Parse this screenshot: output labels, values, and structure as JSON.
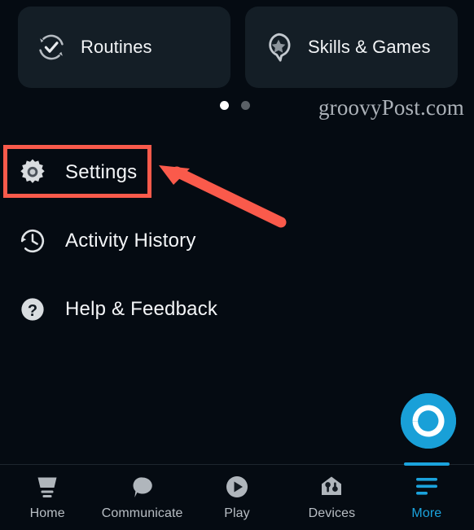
{
  "app": {
    "background_color": "#050b12",
    "card_color": "#141e26",
    "accent_color": "#1ba3dd",
    "annotation_color": "#fa5a4b"
  },
  "cards": [
    {
      "label": "Routines",
      "icon": "routines-refresh-check-icon"
    },
    {
      "label": "Skills & Games",
      "icon": "skills-star-pin-icon"
    }
  ],
  "pager": {
    "total_dots": 2,
    "active_index": 0
  },
  "watermark": {
    "text": "groovyPost.com"
  },
  "menu": {
    "items": [
      {
        "label": "Settings",
        "icon": "gear-icon",
        "highlighted": true
      },
      {
        "label": "Activity History",
        "icon": "clock-history-icon",
        "highlighted": false
      },
      {
        "label": "Help & Feedback",
        "icon": "question-mark-circle-icon",
        "highlighted": false
      }
    ]
  },
  "annotation": {
    "box_target": "Settings",
    "arrow_direction": "up-left",
    "color": "#fa5a4b"
  },
  "alexa_button": {
    "label": "Alexa",
    "icon": "alexa-ring-icon",
    "color": "#19a0d8"
  },
  "bottom_nav": {
    "active": "More",
    "items": [
      {
        "label": "Home",
        "icon": "home-icon"
      },
      {
        "label": "Communicate",
        "icon": "speech-bubble-icon"
      },
      {
        "label": "Play",
        "icon": "play-circle-icon"
      },
      {
        "label": "Devices",
        "icon": "devices-house-icon"
      },
      {
        "label": "More",
        "icon": "more-lines-icon"
      }
    ]
  }
}
